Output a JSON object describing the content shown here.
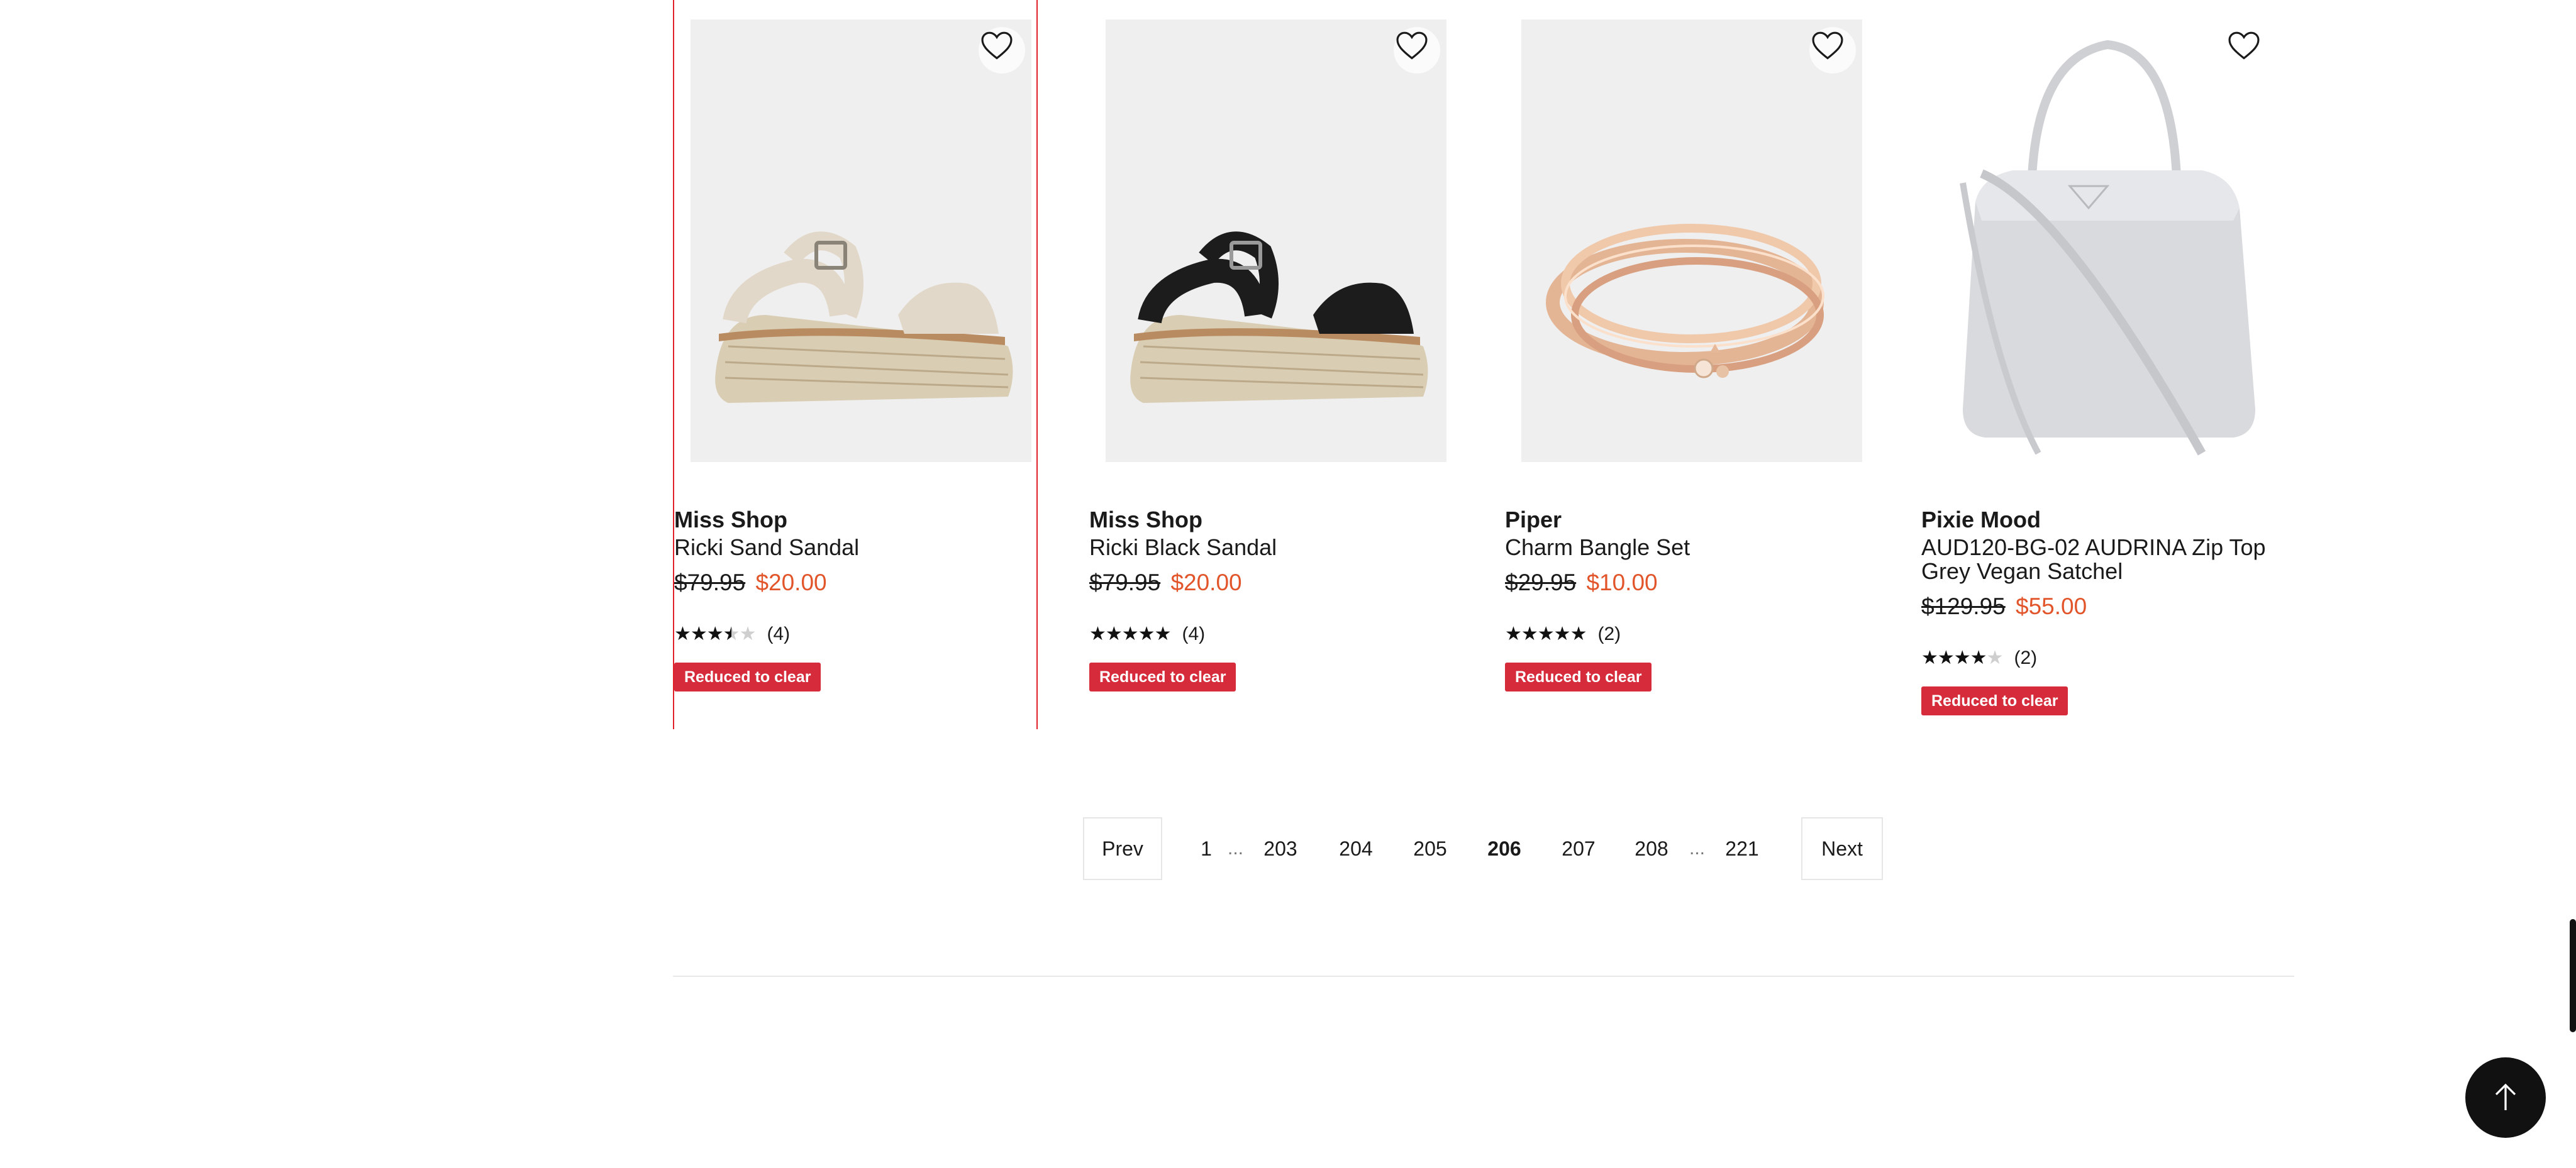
{
  "products": [
    {
      "brand": "Miss Shop",
      "name": "Ricki Sand Sandal",
      "original_price": "$79.95",
      "sale_price": "$20.00",
      "rating_value": 3.5,
      "rating_count": "(4)",
      "badge": "Reduced to clear",
      "image_icon": "sandal-image",
      "color": "#e2d8c9"
    },
    {
      "brand": "Miss Shop",
      "name": "Ricki Black Sandal",
      "original_price": "$79.95",
      "sale_price": "$20.00",
      "rating_value": 5,
      "rating_count": "(4)",
      "badge": "Reduced to clear",
      "image_icon": "sandal-image",
      "color": "#1c1c1c"
    },
    {
      "brand": "Piper",
      "name": "Charm Bangle Set",
      "original_price": "$29.95",
      "sale_price": "$10.00",
      "rating_value": 5,
      "rating_count": "(2)",
      "badge": "Reduced to clear",
      "image_icon": "bangle-image",
      "color": "#e8b898"
    },
    {
      "brand": "Pixie Mood",
      "name": "AUD120-BG-02 AUDRINA Zip Top Grey Vegan Satchel",
      "original_price": "$129.95",
      "sale_price": "$55.00",
      "rating_value": 4,
      "rating_count": "(2)",
      "badge": "Reduced to clear",
      "image_icon": "satchel-image",
      "color": "#d5d6da"
    }
  ],
  "pagination": {
    "prev_label": "Prev",
    "next_label": "Next",
    "ellipsis": "...",
    "pages": [
      "1",
      "203",
      "204",
      "205",
      "206",
      "207",
      "208",
      "221"
    ],
    "current": "206"
  },
  "colors": {
    "sale_price": "#e2552a",
    "badge_bg": "#d62b3a",
    "active_outline": "#e0202a"
  }
}
